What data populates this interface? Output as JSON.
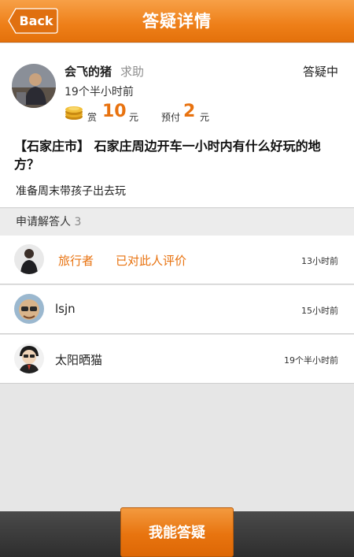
{
  "header": {
    "back_label": "Back",
    "title": "答疑详情"
  },
  "question": {
    "user_name": "会飞的猪",
    "tag": "求助",
    "status": "答疑中",
    "time": "19个半小时前",
    "reward_label": "赏",
    "reward_value": "10",
    "reward_unit": "元",
    "prepay_label": "预付",
    "prepay_value": "2",
    "prepay_unit": "元",
    "title": "【石家庄市】 石家庄周边开车一小时内有什么好玩的地方？",
    "body": "准备周末带孩子出去玩"
  },
  "applicants": {
    "label": "申请解答人",
    "count": "3",
    "items": [
      {
        "name": "旅行者",
        "rated": "已对此人评价",
        "time": "13小时前"
      },
      {
        "name": "lsjn",
        "time": "15小时前"
      },
      {
        "name": "太阳晒猫",
        "time": "19个半小时前"
      }
    ]
  },
  "footer": {
    "answer_button": "我能答疑"
  },
  "colors": {
    "accent": "#ee7f18",
    "dark_bar": "#333333"
  }
}
